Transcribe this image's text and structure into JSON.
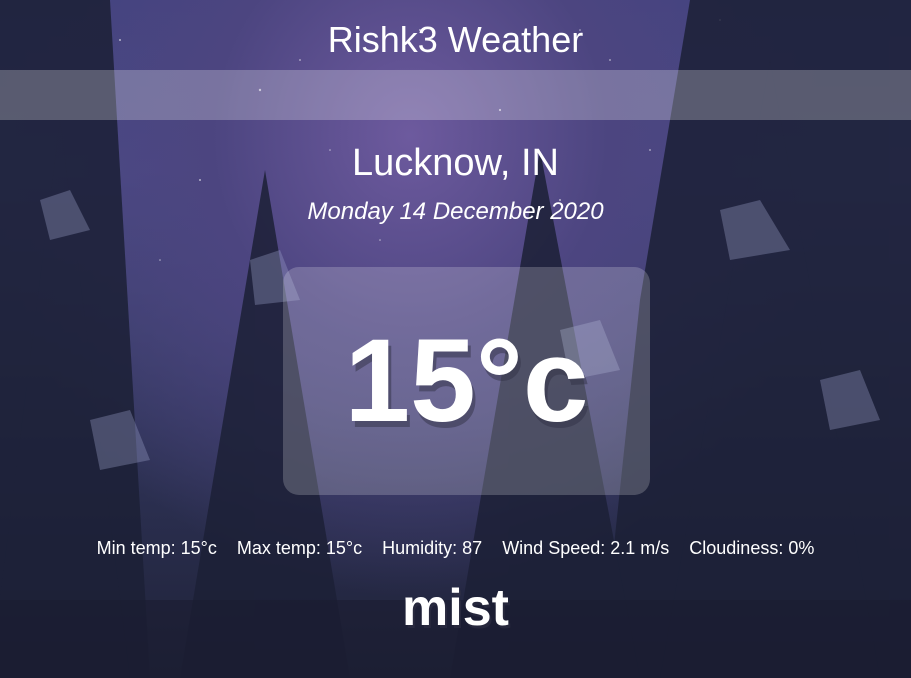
{
  "app": {
    "title": "Rishk3 Weather"
  },
  "search": {
    "placeholder": "",
    "value": ""
  },
  "location": {
    "city_country": "Lucknow, IN",
    "date": "Monday 14 December 2020"
  },
  "current": {
    "temperature": "15°c",
    "description": "mist"
  },
  "stats": [
    {
      "name": "min-temp",
      "text": "Min temp: 15°c"
    },
    {
      "name": "max-temp",
      "text": "Max temp: 15°c"
    },
    {
      "name": "humidity",
      "text": "Humidity: 87"
    },
    {
      "name": "wind-speed",
      "text": "Wind Speed: 2.1 m/s"
    },
    {
      "name": "cloudiness",
      "text": "Cloudiness: 0%"
    }
  ]
}
